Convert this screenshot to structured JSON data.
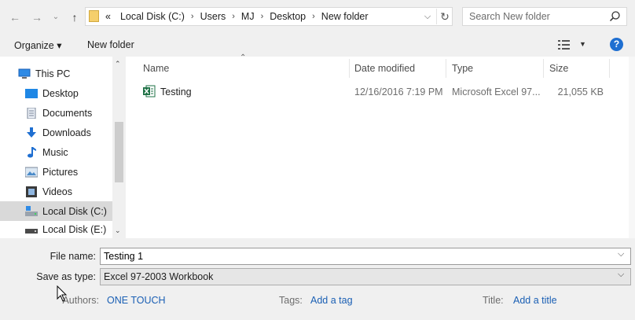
{
  "address": {
    "overflow": "«",
    "crumbs": [
      "Local Disk (C:)",
      "Users",
      "MJ",
      "Desktop",
      "New folder"
    ],
    "search_placeholder": "Search New folder"
  },
  "toolbar": {
    "organize_label": "Organize ▾",
    "new_folder_label": "New folder",
    "help_label": "?"
  },
  "nav": {
    "items": [
      {
        "label": "This PC",
        "icon": "pc-icon"
      },
      {
        "label": "Desktop",
        "icon": "desktop-icon"
      },
      {
        "label": "Documents",
        "icon": "documents-icon"
      },
      {
        "label": "Downloads",
        "icon": "downloads-icon"
      },
      {
        "label": "Music",
        "icon": "music-icon"
      },
      {
        "label": "Pictures",
        "icon": "pictures-icon"
      },
      {
        "label": "Videos",
        "icon": "videos-icon"
      },
      {
        "label": "Local Disk (C:)",
        "icon": "drive-c-icon",
        "selected": true
      },
      {
        "label": "Local Disk (E:)",
        "icon": "drive-e-icon"
      }
    ]
  },
  "columns": {
    "name": "Name",
    "date": "Date modified",
    "type": "Type",
    "size": "Size"
  },
  "files": [
    {
      "name": "Testing",
      "date": "12/16/2016 7:19 PM",
      "type": "Microsoft Excel 97...",
      "size": "21,055 KB"
    }
  ],
  "form": {
    "filename_label": "File name:",
    "filename_value": "Testing 1",
    "savetype_label": "Save as type:",
    "savetype_value": "Excel 97-2003 Workbook"
  },
  "meta": {
    "authors_label": "Authors:",
    "authors_value": "ONE TOUCH",
    "tags_label": "Tags:",
    "tags_value": "Add a tag",
    "title_label": "Title:",
    "title_value": "Add a title"
  },
  "colors": {
    "accent": "#1a5fb4",
    "help": "#1f6fd1",
    "selected_nav": "#d9d9d9",
    "excel_green": "#1e7145"
  }
}
